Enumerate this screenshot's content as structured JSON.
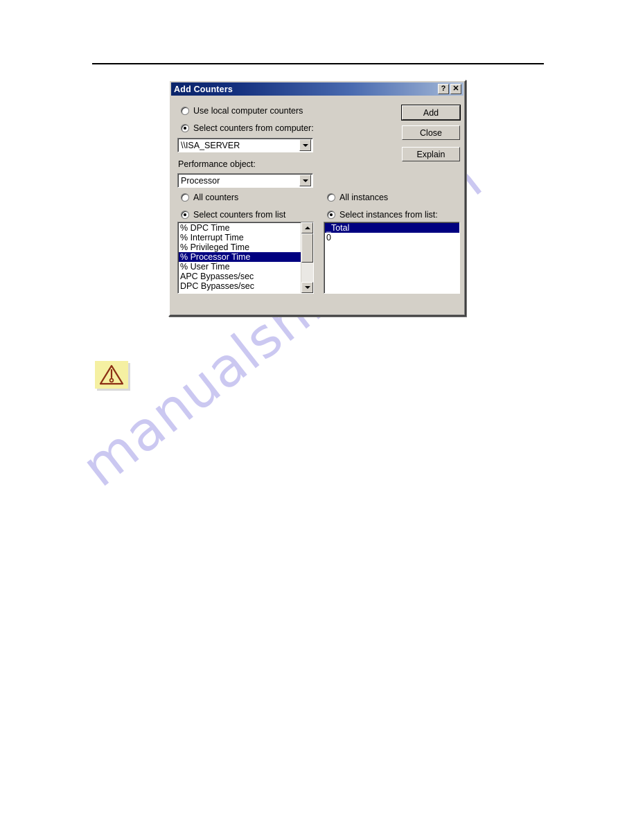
{
  "page": {
    "watermark": "manualshive.com"
  },
  "note": {
    "icon": "warning-triangle-icon"
  },
  "dialog": {
    "title": "Add Counters",
    "titlebar_buttons": [
      {
        "name": "help-button",
        "glyph": "?"
      },
      {
        "name": "close-button",
        "glyph": "✕"
      }
    ],
    "source": {
      "local_option": "Use local computer counters",
      "remote_option": "Select counters from computer:",
      "selected": "remote",
      "computer_value": "\\\\ISA_SERVER"
    },
    "performance_object": {
      "label": "Performance object:",
      "value": "Processor"
    },
    "counters": {
      "all_option": "All counters",
      "list_option": "Select counters from list",
      "selected": "list",
      "items": [
        "% DPC Time",
        "% Interrupt Time",
        "% Privileged Time",
        "% Processor Time",
        "% User Time",
        "APC Bypasses/sec",
        "DPC Bypasses/sec"
      ],
      "selected_item": "% Processor Time"
    },
    "instances": {
      "all_option": "All instances",
      "list_option": "Select instances from list:",
      "selected": "list",
      "items": [
        "_Total",
        "0"
      ],
      "selected_item": "_Total"
    },
    "buttons": [
      {
        "name": "add-button",
        "label": "Add",
        "default": true
      },
      {
        "name": "close-button",
        "label": "Close",
        "default": false
      },
      {
        "name": "explain-button",
        "label": "Explain",
        "default": false
      }
    ]
  }
}
